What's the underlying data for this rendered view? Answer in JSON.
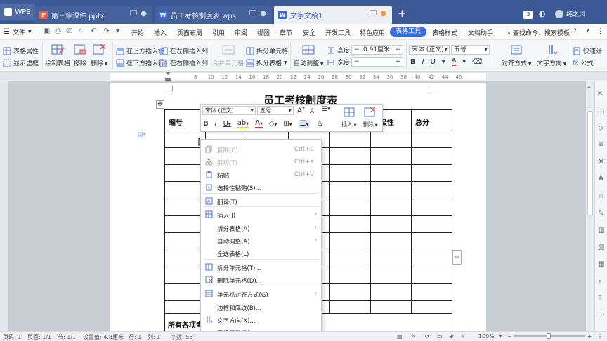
{
  "titlebar": {
    "app_name": "WPS",
    "tabs": [
      {
        "label": "第三章课件.pptx",
        "icon": "P",
        "color": "#e2633f"
      },
      {
        "label": "员工考核制度表.wps",
        "icon": "W",
        "color": "#3d6fd8"
      },
      {
        "label": "文字文稿1",
        "icon": "W",
        "color": "#3d6fd8"
      }
    ],
    "new_tab": "+",
    "window_count": "3",
    "user_name": "纯之风"
  },
  "menubar": {
    "file_label": "文件",
    "items": [
      "开始",
      "插入",
      "页面布局",
      "引用",
      "审阅",
      "视图",
      "章节",
      "安全",
      "开发工具",
      "特色应用"
    ],
    "active": "表格工具",
    "after": [
      "表格样式",
      "文档助手"
    ],
    "search": "查找命令、搜索模板",
    "help": "?"
  },
  "ribbon": {
    "table_props": "表格属性",
    "show_grid": "显示虚框",
    "draw_table": "绘制表格",
    "erase": "擦除",
    "delete": "删除",
    "insert_above": "在上方插入行",
    "insert_below": "在下方插入行",
    "insert_left": "在左侧插入列",
    "insert_right": "在右侧插入列",
    "merge": "合并单元格",
    "split_cell": "拆分单元格",
    "split_table": "拆分表格",
    "auto_adjust": "自动调整",
    "height_label": "高度:",
    "height_value": "0.91厘米",
    "width_label": "宽度:",
    "width_value": "",
    "font_name": "宋体 (正文)",
    "font_size": "五号",
    "align": "对齐方式",
    "text_dir": "文字方向",
    "quick_calc": "快速计",
    "formula": "公式",
    "fx": "fx"
  },
  "ruler": {
    "ticks": [
      "8",
      "10",
      "12",
      "14",
      "16",
      "18",
      "20",
      "22",
      "24",
      "26",
      "28",
      "30",
      "32",
      "34",
      "36",
      "38",
      "40",
      "42",
      "44",
      "46"
    ]
  },
  "document": {
    "title": "员工考核制度表",
    "headers": [
      "编号",
      "",
      "",
      "",
      "极性",
      "总分"
    ],
    "footer_cell": "所有各项考"
  },
  "mini_toolbar": {
    "font": "宋体 (正文)",
    "size": "五号",
    "insert": "插入",
    "delete": "删除"
  },
  "context_menu": [
    {
      "label": "复制(C)",
      "shortcut": "Ctrl+C",
      "disabled": true,
      "icon": "copy-icon"
    },
    {
      "label": "剪切(T)",
      "shortcut": "Ctrl+X",
      "disabled": true,
      "icon": "cut-icon"
    },
    {
      "label": "粘贴",
      "shortcut": "Ctrl+V",
      "disabled": false,
      "icon": "paste-icon"
    },
    {
      "label": "选择性粘贴(S)...",
      "shortcut": "",
      "disabled": false,
      "icon": "paste-special-icon"
    },
    {
      "label": "翻译(T)",
      "shortcut": "",
      "disabled": false,
      "icon": "translate-icon"
    },
    {
      "label": "插入(I)",
      "shortcut": "",
      "disabled": false,
      "icon": "insert-table-icon",
      "submenu": true
    },
    {
      "label": "拆分表格(A)",
      "shortcut": "",
      "disabled": false,
      "icon": "",
      "submenu": true
    },
    {
      "label": "自动调整(A)",
      "shortcut": "",
      "disabled": false,
      "icon": "",
      "submenu": true
    },
    {
      "label": "全选表格(L)",
      "shortcut": "",
      "disabled": false,
      "icon": ""
    },
    {
      "label": "拆分单元格(T)...",
      "shortcut": "",
      "disabled": false,
      "icon": "split-cell-icon"
    },
    {
      "label": "删除单元格(D)...",
      "shortcut": "",
      "disabled": false,
      "icon": "delete-cell-icon"
    },
    {
      "label": "单元格对齐方式(G)",
      "shortcut": "",
      "disabled": false,
      "icon": "cell-align-icon",
      "submenu": true
    },
    {
      "label": "边框和底纹(B)...",
      "shortcut": "",
      "disabled": false,
      "icon": ""
    },
    {
      "label": "文字方向(X)...",
      "shortcut": "",
      "disabled": false,
      "icon": "text-direction-icon"
    },
    {
      "label": "表格属性(R)...",
      "shortcut": "",
      "disabled": false,
      "icon": ""
    }
  ],
  "statusbar": {
    "page_num": "页码: 1",
    "pages": "页面: 1/1",
    "section": "节: 1/1",
    "setting": "设置值: 4.8厘米",
    "row": "行: 1",
    "col": "列: 1",
    "words": "字数: 53",
    "zoom": "100%"
  },
  "colors": {
    "titlebar": "#3b5996",
    "accent": "#3b6fe0",
    "page": "#ffffff",
    "workspace": "#c9cdd4"
  }
}
